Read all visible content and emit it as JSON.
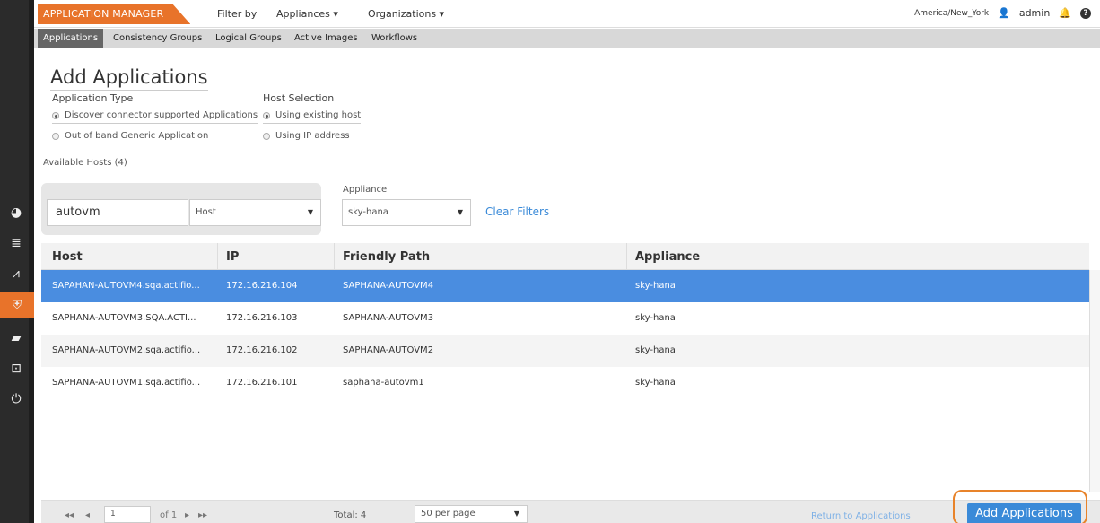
{
  "topbar": {
    "brand": "APPLICATION MANAGER",
    "filter_by": "Filter by",
    "appliances": "Appliances ▾",
    "organizations": "Organizations ▾",
    "timezone": "America/New_York",
    "user": "admin"
  },
  "subnav": {
    "tabs": [
      "Applications",
      "Consistency Groups",
      "Logical Groups",
      "Active Images",
      "Workflows"
    ]
  },
  "page": {
    "title": "Add Applications",
    "application_type_label": "Application Type",
    "host_selection_label": "Host Selection",
    "app_type_option1": "Discover connector supported Applications",
    "app_type_option2": "Out of band Generic Application",
    "host_option1": "Using existing host",
    "host_option2": "Using IP address",
    "available_hosts": "Available Hosts (4)"
  },
  "filters": {
    "search_value": "autovm",
    "search_type": "Host",
    "appliance_label": "Appliance",
    "appliance_value": "sky-hana",
    "clear_filters": "Clear Filters"
  },
  "table": {
    "headers": [
      "Host",
      "IP",
      "Friendly Path",
      "Appliance"
    ],
    "rows": [
      {
        "host": "SAPAHAN-AUTOVM4.sqa.actifio...",
        "ip": "172.16.216.104",
        "path": "SAPHANA-AUTOVM4",
        "appliance": "sky-hana"
      },
      {
        "host": "SAPHANA-AUTOVM3.SQA.ACTI...",
        "ip": "172.16.216.103",
        "path": "SAPHANA-AUTOVM3",
        "appliance": "sky-hana"
      },
      {
        "host": "SAPHANA-AUTOVM2.sqa.actifio...",
        "ip": "172.16.216.102",
        "path": "SAPHANA-AUTOVM2",
        "appliance": "sky-hana"
      },
      {
        "host": "SAPHANA-AUTOVM1.sqa.actifio...",
        "ip": "172.16.216.101",
        "path": "saphana-autovm1",
        "appliance": "sky-hana"
      }
    ]
  },
  "footer": {
    "page_value": "1",
    "of_pages": "of 1",
    "total": "Total:  4",
    "per_page": "50 per page",
    "return_link": "Return to Applications",
    "add_button": "Add Applications"
  },
  "colors": {
    "accent_orange": "#e8732a",
    "selection_blue": "#4a8de0",
    "link_blue": "#3a8ad8"
  }
}
